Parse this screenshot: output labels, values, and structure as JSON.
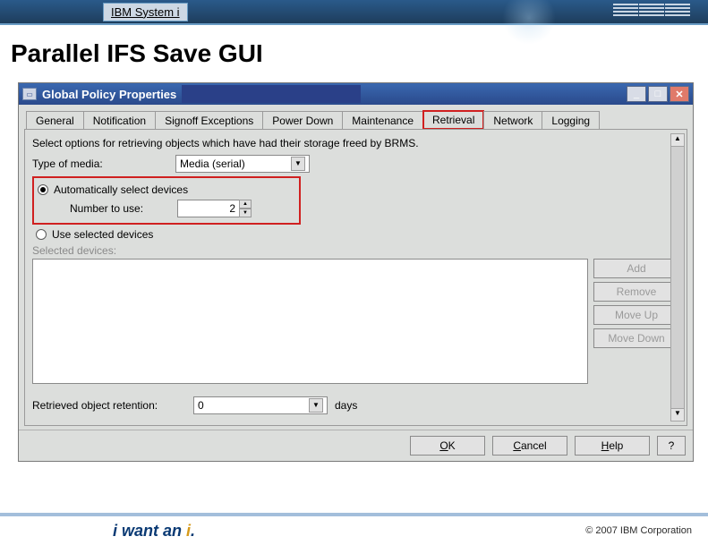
{
  "header": {
    "product_label": "IBM System i"
  },
  "slide": {
    "title": "Parallel IFS Save GUI"
  },
  "dialog": {
    "title": "Global Policy Properties",
    "tabs": [
      "General",
      "Notification",
      "Signoff Exceptions",
      "Power Down",
      "Maintenance",
      "Retrieval",
      "Network",
      "Logging"
    ],
    "active_tab_index": 5,
    "instruction": "Select options for retrieving objects which have had their storage freed by BRMS.",
    "fields": {
      "type_of_media_label": "Type of media:",
      "type_of_media_value": "Media (serial)",
      "auto_select_label": "Automatically select devices",
      "number_to_use_label": "Number to use:",
      "number_to_use_value": "2",
      "use_selected_label": "Use selected devices",
      "selected_devices_label": "Selected devices:",
      "retention_label": "Retrieved object retention:",
      "retention_value": "0",
      "retention_units": "days"
    },
    "side_buttons": {
      "add": "Add",
      "remove": "Remove",
      "up": "Move Up",
      "down": "Move Down"
    },
    "buttons": {
      "ok": "OK",
      "cancel": "Cancel",
      "help": "Help",
      "q": "?"
    }
  },
  "footer": {
    "tagline_pre": "i want an ",
    "tagline_accent": "i",
    "tagline_post": ".",
    "copyright": "© 2007 IBM Corporation"
  }
}
